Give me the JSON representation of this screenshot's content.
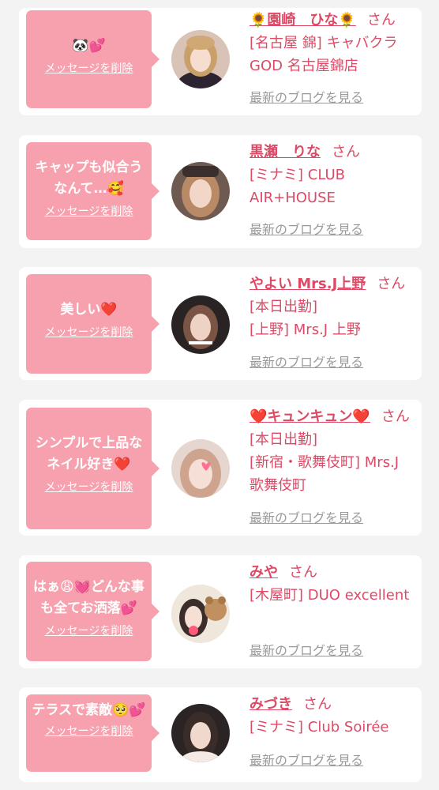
{
  "delete_label": "メッセージを削除",
  "blog_label": "最新のブログを見る",
  "san_label": "さん",
  "colors": {
    "bubble": "#f7a1ae",
    "accent": "#dd4a66",
    "muted": "#9a9a9a",
    "background": "#f3f3f3"
  },
  "items": [
    {
      "message": "🐼💕",
      "name": "🌻園崎　ひな🌻",
      "shop": "[名古屋 錦] キャバクラGOD 名古屋錦店"
    },
    {
      "message": "キャップも似合うなんて…🥰",
      "name": "黒瀬　りな",
      "shop": "[ミナミ] CLUB AIR+HOUSE"
    },
    {
      "message": "美しい❤️",
      "name": "やよい Mrs.J上野",
      "shop": "[本日出勤]\n[上野] Mrs.J 上野"
    },
    {
      "message": "シンプルで上品なネイル好き❤️",
      "name": "❤️キュンキュン❤️",
      "shop": "[本日出勤]\n[新宿・歌舞伎町] Mrs.J 歌舞伎町"
    },
    {
      "message": "はぁ😩💓どんな事も全てお洒落💕",
      "name": "みや",
      "shop": "[木屋町] DUO excellent"
    },
    {
      "message": "テラスで素敵🥺💕",
      "name": "みづき",
      "shop": "[ミナミ] Club Soirée"
    }
  ]
}
